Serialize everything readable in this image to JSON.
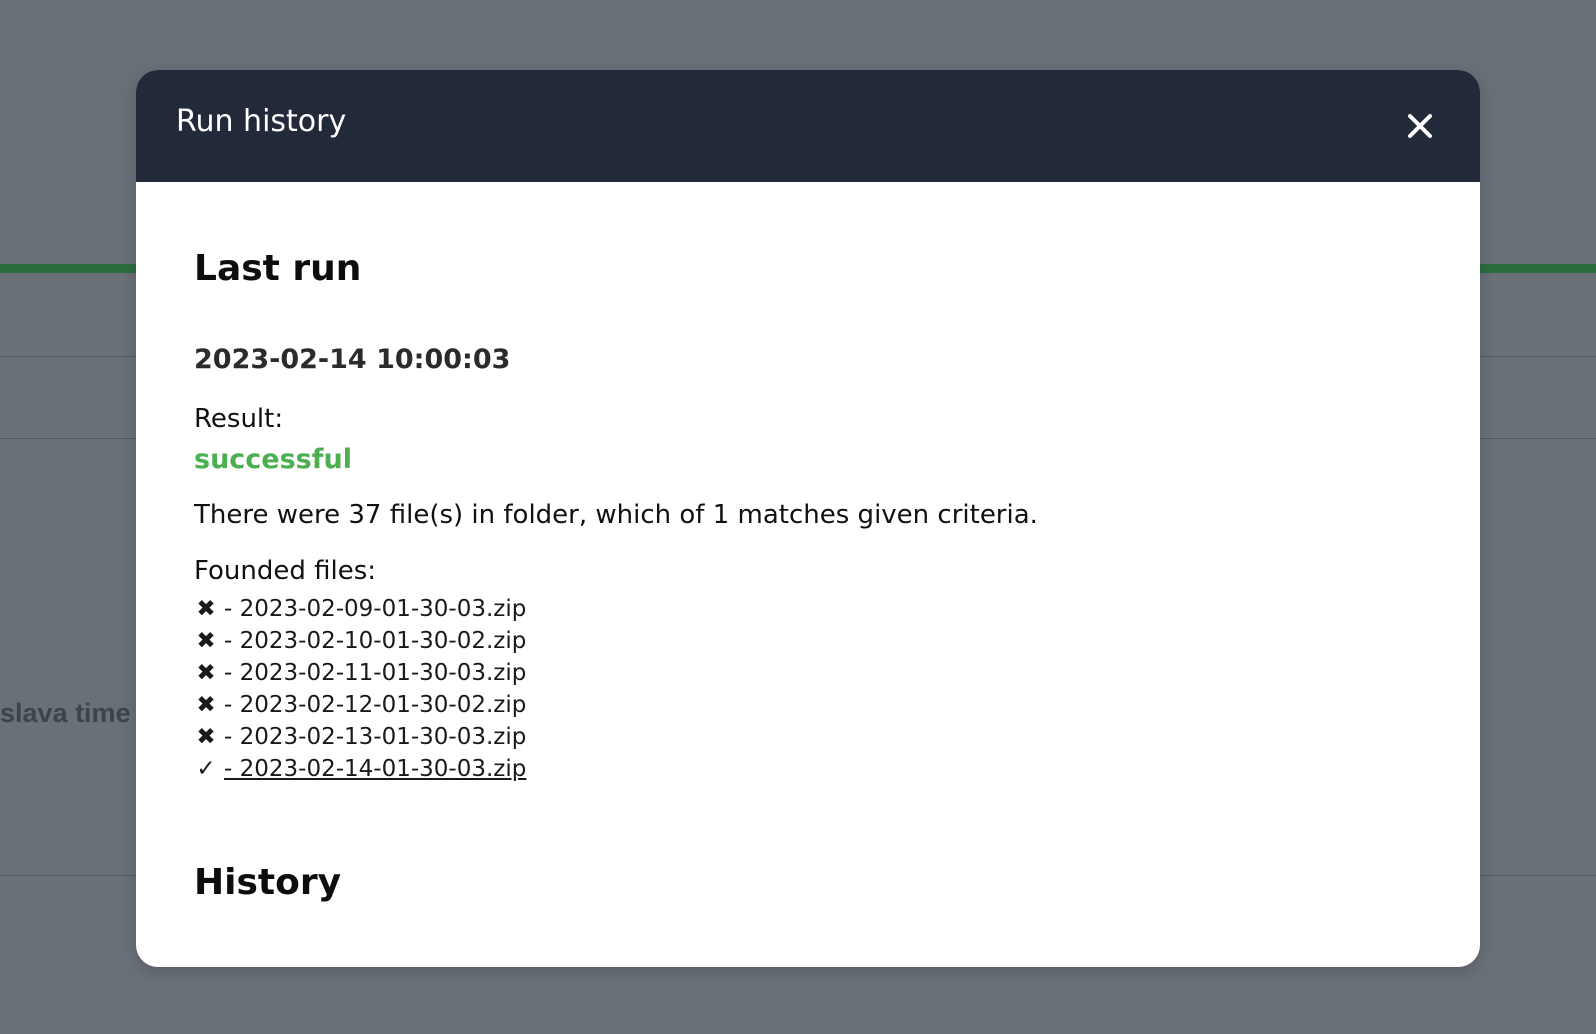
{
  "background": {
    "partial_text": "slava time"
  },
  "modal": {
    "title": "Run history",
    "close_icon": "close-icon"
  },
  "last_run": {
    "heading": "Last run",
    "timestamp": "2023-02-14 10:00:03",
    "result_label": "Result:",
    "result_value": "successful",
    "result_color": "#4caf50",
    "summary": "There were 37 file(s) in folder, which of 1 matches given criteria.",
    "files_label": "Founded files:",
    "files": [
      {
        "mark": "✖",
        "name": "- 2023-02-09-01-30-03.zip",
        "matched": false
      },
      {
        "mark": "✖",
        "name": "- 2023-02-10-01-30-02.zip",
        "matched": false
      },
      {
        "mark": "✖",
        "name": "- 2023-02-11-01-30-03.zip",
        "matched": false
      },
      {
        "mark": "✖",
        "name": "- 2023-02-12-01-30-02.zip",
        "matched": false
      },
      {
        "mark": "✖",
        "name": "- 2023-02-13-01-30-03.zip",
        "matched": false
      },
      {
        "mark": "✓",
        "name": "- 2023-02-14-01-30-03.zip",
        "matched": true
      }
    ]
  },
  "history": {
    "heading": "History"
  }
}
